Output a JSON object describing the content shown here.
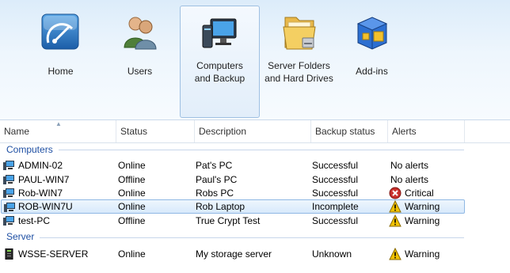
{
  "toolbar": {
    "items": [
      {
        "label1": "Home",
        "label2": "",
        "icon": "home-dashboard-icon"
      },
      {
        "label1": "Users",
        "label2": "",
        "icon": "users-icon"
      },
      {
        "label1": "Computers",
        "label2": "and Backup",
        "icon": "computers-backup-icon",
        "selected": true
      },
      {
        "label1": "Server Folders",
        "label2": "and Hard Drives",
        "icon": "server-folders-icon"
      },
      {
        "label1": "Add-ins",
        "label2": "",
        "icon": "add-ins-icon"
      }
    ]
  },
  "table": {
    "columns": [
      "Name",
      "Status",
      "Description",
      "Backup status",
      "Alerts"
    ],
    "groups": [
      {
        "title": "Computers",
        "rows": [
          {
            "name": "ADMIN-02",
            "status": "Online",
            "description": "Pat's PC",
            "backup": "Successful",
            "alert": "No alerts",
            "alert_icon": ""
          },
          {
            "name": "PAUL-WIN7",
            "status": "Offline",
            "description": "Paul's PC",
            "backup": "Successful",
            "alert": "No alerts",
            "alert_icon": ""
          },
          {
            "name": "Rob-WIN7",
            "status": "Online",
            "description": "Robs PC",
            "backup": "Successful",
            "alert": "Critical",
            "alert_icon": "critical-icon"
          },
          {
            "name": "ROB-WIN7U",
            "status": "Online",
            "description": "Rob Laptop",
            "backup": "Incomplete",
            "alert": "Warning",
            "alert_icon": "warning-icon",
            "selected": true
          },
          {
            "name": "test-PC",
            "status": "Offline",
            "description": "True Crypt Test",
            "backup": "Successful",
            "alert": "Warning",
            "alert_icon": "warning-icon"
          }
        ]
      },
      {
        "title": "Server",
        "rows": [
          {
            "name": "WSSE-SERVER",
            "status": "Online",
            "description": "My storage server",
            "backup": "Unknown",
            "alert": "Warning",
            "alert_icon": "warning-icon"
          }
        ]
      }
    ]
  },
  "colors": {
    "group_title": "#1e4fa3",
    "critical": "#c9302c",
    "warning": "#f2c200",
    "selection_border": "#8fb8e4"
  }
}
